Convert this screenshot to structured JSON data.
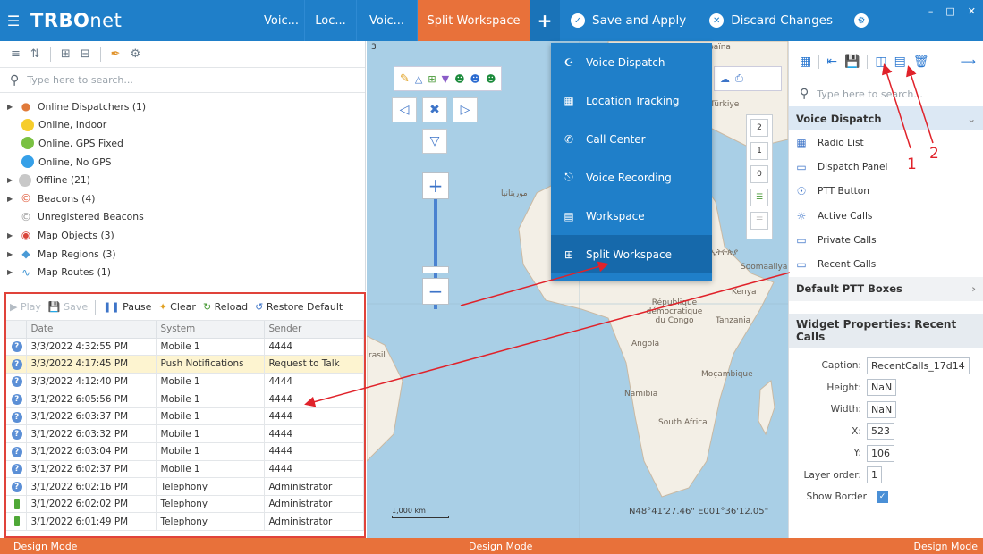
{
  "app": {
    "logo_a": "TRBO",
    "logo_b": "net"
  },
  "topbar": {
    "tabs": [
      "Voic...",
      "Loc...",
      "Voic...",
      "Split Workspace"
    ],
    "plus": "+",
    "save": "Save and Apply",
    "discard": "Discard Changes",
    "win_min": "–",
    "win_max": "□",
    "win_close": "✕"
  },
  "left_tree": {
    "search_placeholder": "Type here to search...",
    "rows": [
      {
        "label": "Online Dispatchers (1)"
      },
      {
        "label": "Online, Indoor"
      },
      {
        "label": "Online, GPS Fixed"
      },
      {
        "label": "Online, No GPS"
      },
      {
        "label": "Offline (21)"
      },
      {
        "label": "Beacons (4)"
      },
      {
        "label": "Unregistered Beacons"
      },
      {
        "label": "Map Objects (3)"
      },
      {
        "label": "Map Regions (3)"
      },
      {
        "label": "Map Routes (1)"
      }
    ]
  },
  "log": {
    "toolbar": {
      "play": "Play",
      "save": "Save",
      "pause": "Pause",
      "clear": "Clear",
      "reload": "Reload",
      "restore": "Restore Default"
    },
    "columns": [
      "Date",
      "System",
      "Sender"
    ],
    "rows": [
      {
        "date": "3/3/2022 4:32:55 PM",
        "system": "Mobile 1",
        "sender": "4444"
      },
      {
        "date": "3/3/2022 4:17:45 PM",
        "system": "Push Notifications",
        "sender": "Request to Talk"
      },
      {
        "date": "3/3/2022 4:12:40 PM",
        "system": "Mobile 1",
        "sender": "4444"
      },
      {
        "date": "3/1/2022 6:05:56 PM",
        "system": "Mobile 1",
        "sender": "4444"
      },
      {
        "date": "3/1/2022 6:03:37 PM",
        "system": "Mobile 1",
        "sender": "4444"
      },
      {
        "date": "3/1/2022 6:03:32 PM",
        "system": "Mobile 1",
        "sender": "4444"
      },
      {
        "date": "3/1/2022 6:03:04 PM",
        "system": "Mobile 1",
        "sender": "4444"
      },
      {
        "date": "3/1/2022 6:02:37 PM",
        "system": "Mobile 1",
        "sender": "4444"
      },
      {
        "date": "3/1/2022 6:02:16 PM",
        "system": "Telephony",
        "sender": "Administrator"
      },
      {
        "date": "3/1/2022 6:02:02 PM",
        "system": "Telephony",
        "sender": "Administrator"
      },
      {
        "date": "3/1/2022 6:01:49 PM",
        "system": "Telephony",
        "sender": "Administrator"
      }
    ]
  },
  "map": {
    "corner": "3",
    "scale": "1,000 km",
    "coords": "N48°41'27.46\" E001°36'12.05\"",
    "labels": {
      "turkiye": "Türkiye",
      "paina": "païna",
      "congo": "République démocratique du Congo",
      "tanzania": "Tanzania",
      "angola": "Angola",
      "mozambique": "Moçambique",
      "namibia": "Namibia",
      "south_africa": "South Africa",
      "somalia": "Soomaaliya",
      "kenya": "Kenya",
      "brasil": "rasil",
      "mauritania": "موريتانيا",
      "ethiopia": "ኢትዮጵያ"
    },
    "layers": [
      "2",
      "1",
      "0"
    ]
  },
  "dropdown": {
    "items": [
      {
        "label": "Voice Dispatch"
      },
      {
        "label": "Location Tracking"
      },
      {
        "label": "Call Center"
      },
      {
        "label": "Voice Recording"
      },
      {
        "label": "Workspace"
      },
      {
        "label": "Split Workspace"
      }
    ]
  },
  "right": {
    "search_placeholder": "Type here to search...",
    "group_open": "Voice Dispatch",
    "items": [
      "Radio List",
      "Dispatch Panel",
      "PTT Button",
      "Active Calls",
      "Private Calls",
      "Recent Calls"
    ],
    "group_closed": "Default PTT Boxes",
    "props_title": "Widget Properties: Recent Calls",
    "props": {
      "caption_label": "Caption:",
      "caption": "RecentCalls_17d14",
      "height_label": "Height:",
      "height": "NaN",
      "width_label": "Width:",
      "width": "NaN",
      "x_label": "X:",
      "x": "523",
      "y_label": "Y:",
      "y": "106",
      "layer_label": "Layer order:",
      "layer": "1",
      "border_label": "Show Border"
    }
  },
  "annotations": {
    "one": "1",
    "two": "2"
  },
  "status": {
    "left": "Design Mode",
    "center": "Design Mode",
    "right": "Design Mode"
  },
  "colors": {
    "topbar": "#1f7fc9",
    "accent": "#e8713a",
    "annotation": "#e0222a"
  }
}
